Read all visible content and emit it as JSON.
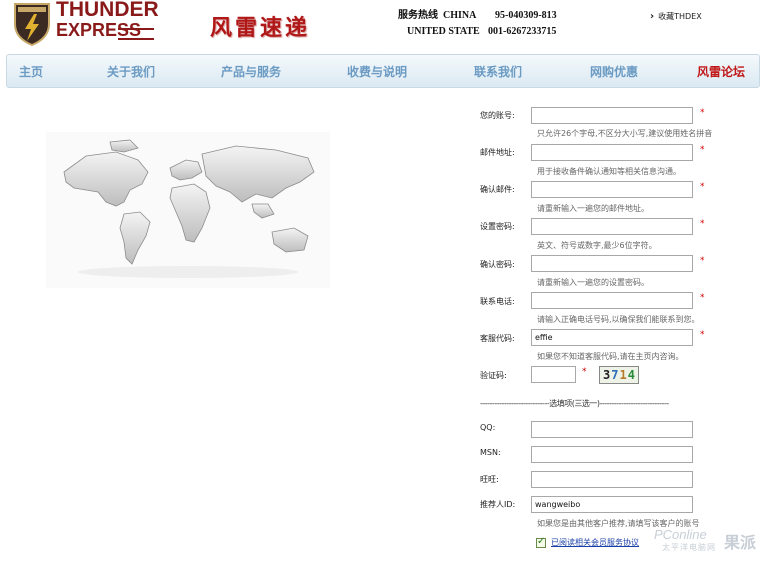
{
  "header": {
    "logo_line1": "THUNDER",
    "logo_line2": "EXPRESS",
    "brand_cn": "风雷速递",
    "hotline_label": "服务热线",
    "hotline_region1": "CHINA",
    "hotline_number1": "95-040309-813",
    "hotline_region2": "UNITED STATE",
    "hotline_number2": "001-6267233715",
    "favorite": "收藏THDEX"
  },
  "nav": {
    "items": [
      {
        "label": "主页"
      },
      {
        "label": "关于我们"
      },
      {
        "label": "产品与服务"
      },
      {
        "label": "收费与说明"
      },
      {
        "label": "联系我们"
      },
      {
        "label": "网购优惠"
      },
      {
        "label": "风雷论坛"
      }
    ]
  },
  "form": {
    "account_label": "您的账号:",
    "account_hint": "只允许26个字母,不区分大小写,建议使用姓名拼音",
    "email_label": "邮件地址:",
    "email_hint": "用于接收备件确认通知等相关信息沟通。",
    "confirm_email_label": "确认邮件:",
    "confirm_email_hint": "请重新输入一遍您的邮件地址。",
    "password_label": "设置密码:",
    "password_hint": "英文、符号或数字,最少6位字符。",
    "confirm_password_label": "确认密码:",
    "confirm_password_hint": "请重新输入一遍您的设置密码。",
    "phone_label": "联系电话:",
    "phone_hint": "请输入正确电话号码,以确保我们能联系到您。",
    "service_code_label": "客服代码:",
    "service_code_value": "effie",
    "service_code_hint": "如果您不知道客服代码,请在主页内咨询。",
    "captcha_label": "验证码:",
    "captcha_chars": [
      "3",
      "7",
      "1",
      "4"
    ],
    "required_mark": "*",
    "optional_divider": "-----------------------------选填项(三选一)-----------------------------",
    "qq_label": "QQ:",
    "msn_label": "MSN:",
    "wangwang_label": "旺旺:",
    "referrer_label": "推荐人ID:",
    "referrer_value": "wangweibo",
    "referrer_hint": "如果您是由其他客户推荐,请填写该客户的账号",
    "agree_text": "已阅读相关会员服务协议"
  },
  "watermark": {
    "site": "PConline",
    "sub": "太平洋电脑网",
    "brand": "果派"
  }
}
